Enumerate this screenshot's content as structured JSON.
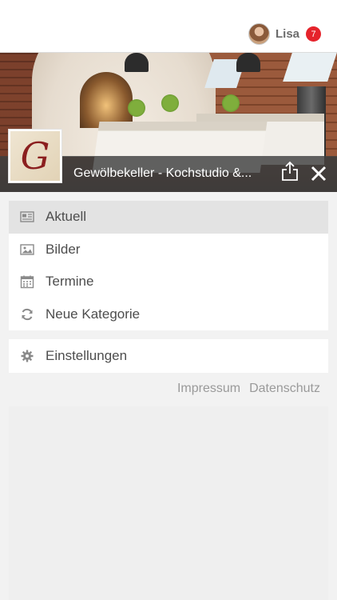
{
  "user": {
    "name": "Lisa",
    "notifications": "7"
  },
  "header": {
    "title": "Gewölbekeller - Kochstudio &..."
  },
  "logo": {
    "letter": "G"
  },
  "menu": {
    "items": [
      {
        "label": "Aktuell",
        "icon": "newspaper-icon",
        "active": true
      },
      {
        "label": "Bilder",
        "icon": "image-icon"
      },
      {
        "label": "Termine",
        "icon": "calendar-icon"
      },
      {
        "label": "Neue Kategorie",
        "icon": "refresh-icon"
      }
    ],
    "settings": {
      "label": "Einstellungen",
      "icon": "gear-icon"
    }
  },
  "footer": {
    "impressum": "Impressum",
    "datenschutz": "Datenschutz"
  },
  "colors": {
    "badge": "#e5232b",
    "titlebar": "#404040",
    "active_item": "#e3e3e3"
  }
}
